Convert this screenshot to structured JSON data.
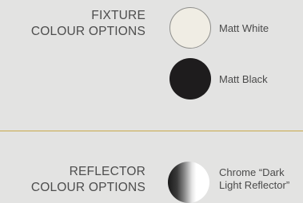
{
  "fixture": {
    "title_line1": "FIXTURE",
    "title_line2": "COLOUR OPTIONS",
    "options": [
      {
        "label": "Matt White",
        "color": "#f0ede4"
      },
      {
        "label": "Matt Black",
        "color": "#1e1c1d"
      }
    ]
  },
  "reflector": {
    "title_line1": "REFLECTOR",
    "title_line2": "COLOUR OPTIONS",
    "options": [
      {
        "label_line1": "Chrome “Dark",
        "label_line2": "Light Reflector”"
      }
    ]
  },
  "divider_color": "#c8a94a",
  "background_color": "#e3e3e2"
}
